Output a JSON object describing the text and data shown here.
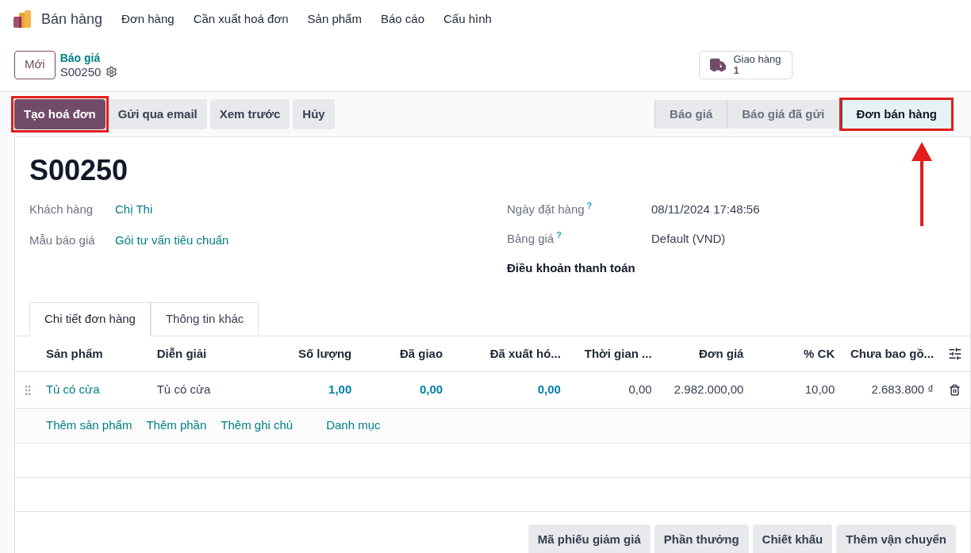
{
  "app": {
    "name": "Bán hàng",
    "menu": [
      "Đơn hàng",
      "Cần xuất hoá đơn",
      "Sản phẩm",
      "Báo cáo",
      "Cấu hình"
    ]
  },
  "control": {
    "new_button": "Mới",
    "breadcrumb": {
      "parent": "Báo giá",
      "current": "S00250"
    },
    "smart_button": {
      "label": "Giao hàng",
      "count": "1"
    }
  },
  "actions": [
    {
      "label": "Tạo hoá đơn",
      "kind": "primary",
      "highlighted": true
    },
    {
      "label": "Gửi qua email",
      "kind": "secondary",
      "highlighted": false
    },
    {
      "label": "Xem trước",
      "kind": "secondary",
      "highlighted": false
    },
    {
      "label": "Hủy",
      "kind": "secondary",
      "highlighted": false
    }
  ],
  "stages": [
    {
      "label": "Báo giá",
      "selected": false,
      "highlighted": false
    },
    {
      "label": "Báo giá đã gửi",
      "selected": false,
      "highlighted": false
    },
    {
      "label": "Đơn bán hàng",
      "selected": true,
      "highlighted": true
    }
  ],
  "form": {
    "title": "S00250",
    "left_fields": [
      {
        "kind": "field",
        "label": "Khách hàng",
        "value": "Chị Thi",
        "link": true
      },
      {
        "kind": "field",
        "label": "Mẫu báo giá",
        "value": "Gói tư vấn tiêu chuẩn",
        "link": true
      }
    ],
    "right_fields": [
      {
        "kind": "field",
        "label": "Ngày đặt hàng",
        "help": "?",
        "value": "08/11/2024 17:48:56",
        "link": false
      },
      {
        "kind": "field",
        "label": "Bảng giá",
        "help": "?",
        "value": "Default (VND)",
        "link": false
      },
      {
        "kind": "heading",
        "label": "Điều khoản thanh toán"
      }
    ]
  },
  "tabs": [
    {
      "label": "Chi tiết đơn hàng",
      "selected": true
    },
    {
      "label": "Thông tin khác",
      "selected": false
    }
  ],
  "table": {
    "columns": [
      {
        "label": "Sản phẩm"
      },
      {
        "label": "Diễn giải"
      },
      {
        "label": "Số lượng"
      },
      {
        "label": "Đã giao"
      },
      {
        "label": "Đã xuất hó..."
      },
      {
        "label": "Thời gian ..."
      },
      {
        "label": "Đơn giá"
      },
      {
        "label": "% CK"
      },
      {
        "label": "Chưa bao gồ..."
      }
    ],
    "rows": [
      {
        "cells": [
          {
            "text": "Tủ có cửa",
            "kind": "link"
          },
          {
            "text": "Tủ có cửa",
            "kind": "text"
          },
          {
            "text": "1,00",
            "kind": "strong"
          },
          {
            "text": "0,00",
            "kind": "strong"
          },
          {
            "text": "0,00",
            "kind": "strong"
          },
          {
            "text": "0,00",
            "kind": "text"
          },
          {
            "text": "2.982.000,00",
            "kind": "text"
          },
          {
            "text": "10,00",
            "kind": "text"
          },
          {
            "text": "2.683.800 ₫",
            "kind": "text"
          }
        ]
      }
    ],
    "add_links": [
      "Thêm sản phẩm",
      "Thêm phần",
      "Thêm ghi chú",
      "Danh mục"
    ]
  },
  "footer_buttons": [
    "Mã phiếu giảm giá",
    "Phần thưởng",
    "Chiết khấu",
    "Thêm vận chuyển"
  ]
}
